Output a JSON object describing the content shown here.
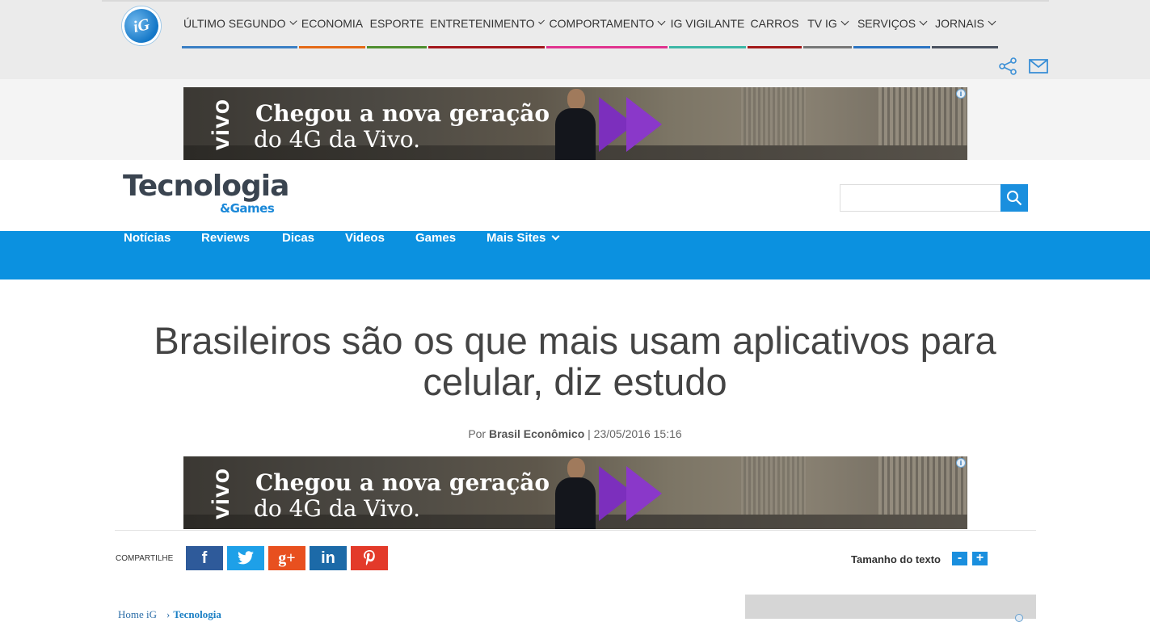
{
  "ig_header": {
    "logo_text": "iG",
    "nav": [
      {
        "label": "ÚLTIMO SEGUNDO",
        "has_dropdown": true,
        "color": "#3b7fc4"
      },
      {
        "label": "ECONOMIA",
        "has_dropdown": false,
        "color": "#e46a17"
      },
      {
        "label": "ESPORTE",
        "has_dropdown": false,
        "color": "#4f8f2f"
      },
      {
        "label": "ENTRETENIMENTO",
        "has_dropdown": true,
        "color": "#a3171c"
      },
      {
        "label": "COMPORTAMENTO",
        "has_dropdown": true,
        "color": "#e0338f"
      },
      {
        "label": "IG VIGILANTE",
        "has_dropdown": false,
        "color": "#3db7a6"
      },
      {
        "label": "CARROS",
        "has_dropdown": false,
        "color": "#a31a1a"
      },
      {
        "label": "TV IG",
        "has_dropdown": true,
        "color": "#777777"
      },
      {
        "label": "SERVIÇOS",
        "has_dropdown": true,
        "color": "#2b74c2"
      },
      {
        "label": "JORNAIS",
        "has_dropdown": true,
        "color": "#4a5260"
      }
    ],
    "icons": [
      "share-icon",
      "mail-icon"
    ]
  },
  "ads": {
    "brand": "vivo",
    "line1": "Chegou a nova geração",
    "line2": "do 4G da Vivo.",
    "info_glyph": "i"
  },
  "section": {
    "title": "Tecnologia",
    "subtitle": "&Games",
    "search": {
      "value": "",
      "placeholder": ""
    },
    "nav": [
      {
        "label": "Notícias"
      },
      {
        "label": "Reviews"
      },
      {
        "label": "Dicas"
      },
      {
        "label": "Videos"
      },
      {
        "label": "Games"
      },
      {
        "label": "Mais Sites",
        "has_dropdown": true
      }
    ],
    "accent_color": "#0b91e0"
  },
  "article": {
    "headline": "Brasileiros são os que mais usam aplicativos para celular, diz estudo",
    "byline_prefix": "Por",
    "author": "Brasil Econômico",
    "date": "| 23/05/2016 15:16"
  },
  "share": {
    "label": "COMPARTILHE",
    "buttons": [
      {
        "name": "facebook",
        "glyph": "f",
        "color": "#2e5a9a"
      },
      {
        "name": "twitter",
        "glyph": "t",
        "color": "#1ea0e8"
      },
      {
        "name": "google-plus",
        "glyph": "g+",
        "color": "#e8501f"
      },
      {
        "name": "linkedin",
        "glyph": "in",
        "color": "#1c6aa8"
      },
      {
        "name": "pinterest",
        "glyph": "P",
        "color": "#e33a2a"
      }
    ]
  },
  "text_size": {
    "label": "Tamanho do texto",
    "decrease": "-",
    "increase": "+"
  },
  "breadcrumb": {
    "home": "Home iG",
    "separator": "›",
    "current": "Tecnologia"
  }
}
